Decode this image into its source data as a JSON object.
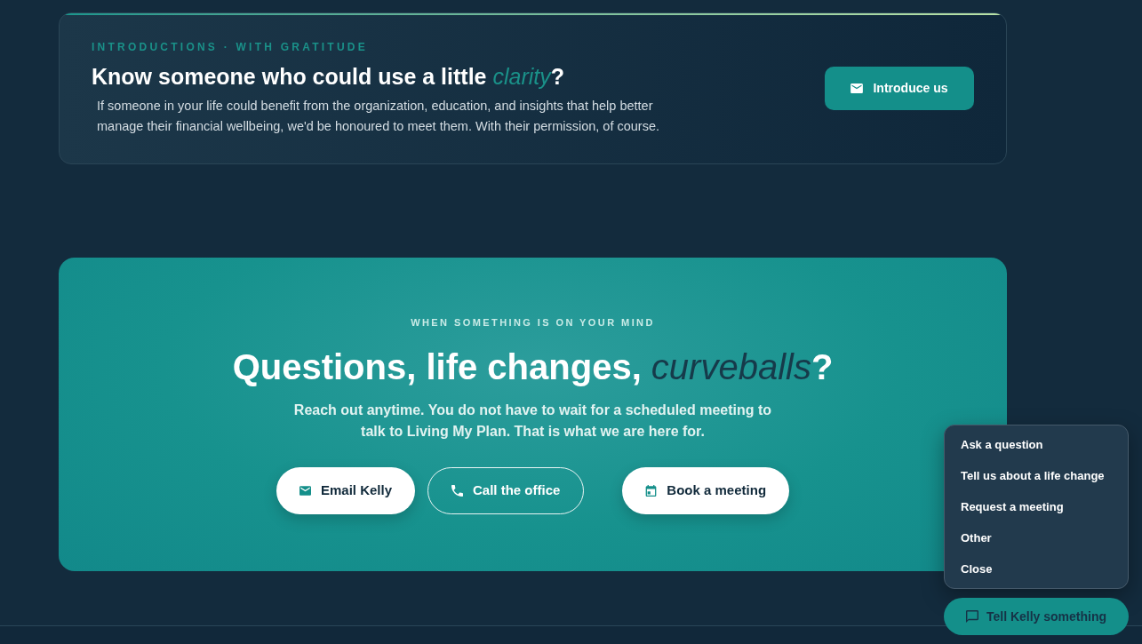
{
  "introduction": {
    "eyebrow": "INTRODUCTIONS · WITH GRATITUDE",
    "heading": "Know someone who could use a little *clarity*?",
    "body": "If someone in your life could benefit from the organization, education, and insights that help better manage their financial wellbeing, we'd be honoured to meet them. With their permission, of course.",
    "button": {
      "label": "Introduce us"
    }
  },
  "contact": {
    "eyebrow": "WHEN SOMETHING IS ON YOUR MIND",
    "heading": "Questions, life changes, *curveballs*?",
    "body": "Reach out anytime. You do not have to wait for a scheduled meeting to talk to Living My Plan. That is what we are here for.",
    "buttons": [
      {
        "label": "Email Kelly",
        "kind": "solid"
      },
      {
        "label": "Call the office",
        "kind": "outline"
      },
      {
        "label": "Book a meeting",
        "kind": "solid"
      }
    ]
  },
  "chat_widget": {
    "menu_items": [
      "Ask a question",
      "Tell us about a life change",
      "Request a meeting",
      "Other",
      "Close"
    ],
    "launcher": {
      "label": "Tell Kelly something",
      "expanded": true
    }
  }
}
